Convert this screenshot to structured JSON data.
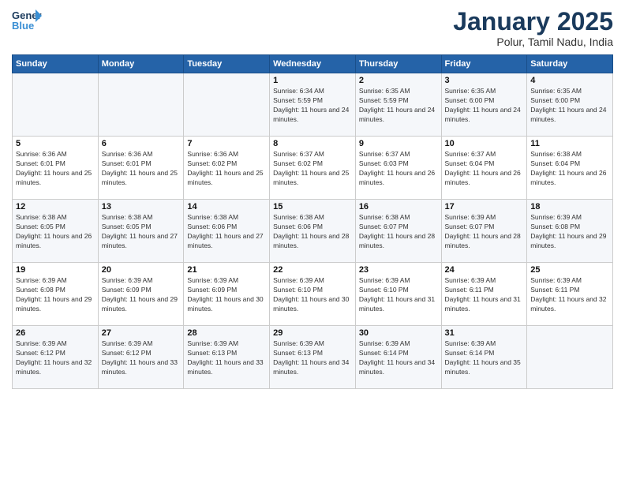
{
  "header": {
    "logo_line1": "General",
    "logo_line2": "Blue",
    "month": "January 2025",
    "location": "Polur, Tamil Nadu, India"
  },
  "days_of_week": [
    "Sunday",
    "Monday",
    "Tuesday",
    "Wednesday",
    "Thursday",
    "Friday",
    "Saturday"
  ],
  "weeks": [
    [
      {
        "day": "",
        "info": ""
      },
      {
        "day": "",
        "info": ""
      },
      {
        "day": "",
        "info": ""
      },
      {
        "day": "1",
        "info": "Sunrise: 6:34 AM\nSunset: 5:59 PM\nDaylight: 11 hours and 24 minutes."
      },
      {
        "day": "2",
        "info": "Sunrise: 6:35 AM\nSunset: 5:59 PM\nDaylight: 11 hours and 24 minutes."
      },
      {
        "day": "3",
        "info": "Sunrise: 6:35 AM\nSunset: 6:00 PM\nDaylight: 11 hours and 24 minutes."
      },
      {
        "day": "4",
        "info": "Sunrise: 6:35 AM\nSunset: 6:00 PM\nDaylight: 11 hours and 24 minutes."
      }
    ],
    [
      {
        "day": "5",
        "info": "Sunrise: 6:36 AM\nSunset: 6:01 PM\nDaylight: 11 hours and 25 minutes."
      },
      {
        "day": "6",
        "info": "Sunrise: 6:36 AM\nSunset: 6:01 PM\nDaylight: 11 hours and 25 minutes."
      },
      {
        "day": "7",
        "info": "Sunrise: 6:36 AM\nSunset: 6:02 PM\nDaylight: 11 hours and 25 minutes."
      },
      {
        "day": "8",
        "info": "Sunrise: 6:37 AM\nSunset: 6:02 PM\nDaylight: 11 hours and 25 minutes."
      },
      {
        "day": "9",
        "info": "Sunrise: 6:37 AM\nSunset: 6:03 PM\nDaylight: 11 hours and 26 minutes."
      },
      {
        "day": "10",
        "info": "Sunrise: 6:37 AM\nSunset: 6:04 PM\nDaylight: 11 hours and 26 minutes."
      },
      {
        "day": "11",
        "info": "Sunrise: 6:38 AM\nSunset: 6:04 PM\nDaylight: 11 hours and 26 minutes."
      }
    ],
    [
      {
        "day": "12",
        "info": "Sunrise: 6:38 AM\nSunset: 6:05 PM\nDaylight: 11 hours and 26 minutes."
      },
      {
        "day": "13",
        "info": "Sunrise: 6:38 AM\nSunset: 6:05 PM\nDaylight: 11 hours and 27 minutes."
      },
      {
        "day": "14",
        "info": "Sunrise: 6:38 AM\nSunset: 6:06 PM\nDaylight: 11 hours and 27 minutes."
      },
      {
        "day": "15",
        "info": "Sunrise: 6:38 AM\nSunset: 6:06 PM\nDaylight: 11 hours and 28 minutes."
      },
      {
        "day": "16",
        "info": "Sunrise: 6:38 AM\nSunset: 6:07 PM\nDaylight: 11 hours and 28 minutes."
      },
      {
        "day": "17",
        "info": "Sunrise: 6:39 AM\nSunset: 6:07 PM\nDaylight: 11 hours and 28 minutes."
      },
      {
        "day": "18",
        "info": "Sunrise: 6:39 AM\nSunset: 6:08 PM\nDaylight: 11 hours and 29 minutes."
      }
    ],
    [
      {
        "day": "19",
        "info": "Sunrise: 6:39 AM\nSunset: 6:08 PM\nDaylight: 11 hours and 29 minutes."
      },
      {
        "day": "20",
        "info": "Sunrise: 6:39 AM\nSunset: 6:09 PM\nDaylight: 11 hours and 29 minutes."
      },
      {
        "day": "21",
        "info": "Sunrise: 6:39 AM\nSunset: 6:09 PM\nDaylight: 11 hours and 30 minutes."
      },
      {
        "day": "22",
        "info": "Sunrise: 6:39 AM\nSunset: 6:10 PM\nDaylight: 11 hours and 30 minutes."
      },
      {
        "day": "23",
        "info": "Sunrise: 6:39 AM\nSunset: 6:10 PM\nDaylight: 11 hours and 31 minutes."
      },
      {
        "day": "24",
        "info": "Sunrise: 6:39 AM\nSunset: 6:11 PM\nDaylight: 11 hours and 31 minutes."
      },
      {
        "day": "25",
        "info": "Sunrise: 6:39 AM\nSunset: 6:11 PM\nDaylight: 11 hours and 32 minutes."
      }
    ],
    [
      {
        "day": "26",
        "info": "Sunrise: 6:39 AM\nSunset: 6:12 PM\nDaylight: 11 hours and 32 minutes."
      },
      {
        "day": "27",
        "info": "Sunrise: 6:39 AM\nSunset: 6:12 PM\nDaylight: 11 hours and 33 minutes."
      },
      {
        "day": "28",
        "info": "Sunrise: 6:39 AM\nSunset: 6:13 PM\nDaylight: 11 hours and 33 minutes."
      },
      {
        "day": "29",
        "info": "Sunrise: 6:39 AM\nSunset: 6:13 PM\nDaylight: 11 hours and 34 minutes."
      },
      {
        "day": "30",
        "info": "Sunrise: 6:39 AM\nSunset: 6:14 PM\nDaylight: 11 hours and 34 minutes."
      },
      {
        "day": "31",
        "info": "Sunrise: 6:39 AM\nSunset: 6:14 PM\nDaylight: 11 hours and 35 minutes."
      },
      {
        "day": "",
        "info": ""
      }
    ]
  ]
}
